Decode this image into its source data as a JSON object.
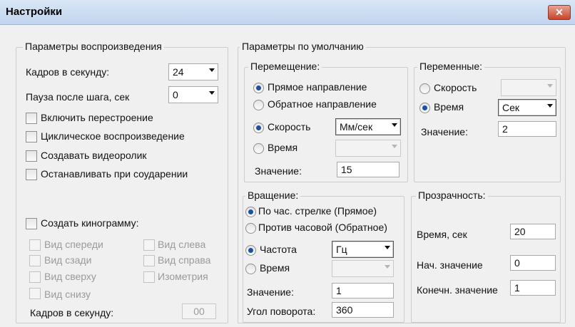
{
  "window": {
    "title": "Настройки",
    "close_symbol": "✕"
  },
  "playback": {
    "legend": "Параметры воспроизведения",
    "fps_label": "Кадров в секунду:",
    "fps_value": "24",
    "pause_label": "Пауза после шага, сек",
    "pause_value": "0",
    "checkboxes": [
      {
        "label": "Включить перестроение",
        "checked": false
      },
      {
        "label": "Циклическое воспроизведение",
        "checked": false
      },
      {
        "label": "Создавать видеоролик",
        "checked": false
      },
      {
        "label": "Останавливать при соударении",
        "checked": false
      }
    ],
    "kinogram_label": "Создать кинограмму:",
    "views": [
      "Вид спереди",
      "Вид слева",
      "Вид сзади",
      "Вид справа",
      "Вид сверху",
      "Изометрия",
      "Вид снизу"
    ],
    "kinogram_fps_label": "Кадров в секунду:",
    "kinogram_fps_value": "00"
  },
  "defaults": {
    "legend": "Параметры по умолчанию",
    "movement": {
      "legend": "Перемещение:",
      "forward": "Прямое направление",
      "backward": "Обратное направление",
      "speed": "Скорость",
      "speed_unit": "Мм/сек",
      "time": "Время",
      "value_label": "Значение:",
      "value": "15"
    },
    "variables": {
      "legend": "Переменные:",
      "speed": "Скорость",
      "time": "Время",
      "time_unit": "Сек",
      "value_label": "Значение:",
      "value": "2"
    },
    "rotation": {
      "legend": "Вращение:",
      "clockwise": "По час. стрелке (Прямое)",
      "counterclockwise": "Против часовой (Обратное)",
      "frequency": "Частота",
      "frequency_unit": "Гц",
      "time": "Время",
      "value_label": "Значение:",
      "value": "1",
      "angle_label": "Угол поворота:",
      "angle_value": "360"
    },
    "transparency": {
      "legend": "Прозрачность:",
      "time_label": "Время, сек",
      "time_value": "20",
      "start_label": "Нач. значение",
      "start_value": "0",
      "end_label": "Конечн. значение",
      "end_value": "1"
    }
  }
}
